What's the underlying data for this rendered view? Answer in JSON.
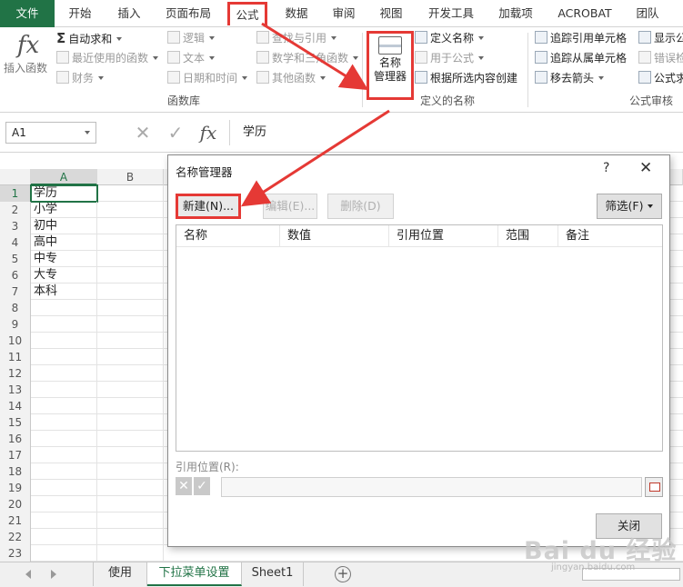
{
  "ribbon_tabs": [
    "文件",
    "开始",
    "插入",
    "页面布局",
    "公式",
    "数据",
    "审阅",
    "视图",
    "开发工具",
    "加载项",
    "ACROBAT",
    "团队"
  ],
  "ribbon": {
    "insert_function": "插入函数",
    "library": {
      "autosum": "自动求和",
      "recent": "最近使用的函数",
      "financial": "财务",
      "logical": "逻辑",
      "text": "文本",
      "datetime": "日期和时间",
      "lookup": "查找与引用",
      "math": "数学和三角函数",
      "more": "其他函数",
      "group_label": "函数库"
    },
    "names": {
      "name_manager": [
        "名称",
        "管理器"
      ],
      "define_name": "定义名称",
      "use_in_formula": "用于公式",
      "create_from_selection": "根据所选内容创建",
      "group_label": "定义的名称"
    },
    "audit": {
      "trace_precedents": "追踪引用单元格",
      "trace_dependents": "追踪从属单元格",
      "remove_arrows": "移去箭头",
      "show_formulas": "显示公",
      "error_checking": "错误检",
      "evaluate": "公式求",
      "group_label": "公式审核"
    }
  },
  "formula_bar": {
    "name_box": "A1",
    "fx": "fx",
    "content": "学历"
  },
  "grid": {
    "columns": [
      "A",
      "B"
    ],
    "row_numbers": [
      "1",
      "2",
      "3",
      "4",
      "5",
      "6",
      "7",
      "8",
      "9",
      "10",
      "11",
      "12",
      "13",
      "14",
      "15",
      "16",
      "17",
      "18",
      "19",
      "20",
      "21",
      "22",
      "23"
    ],
    "column_a": [
      "学历",
      "小学",
      "初中",
      "高中",
      "中专",
      "大专",
      "本科"
    ]
  },
  "sheets": [
    "使用表",
    "下拉菜单设置",
    "Sheet1"
  ],
  "active_sheet": "下拉菜单设置",
  "dialog": {
    "title": "名称管理器",
    "help": "?",
    "close": "✕",
    "new_btn": "新建(N)...",
    "edit_btn": "编辑(E)...",
    "delete_btn": "删除(D)",
    "filter_btn": "筛选(F)",
    "list_headers": [
      "名称",
      "数值",
      "引用位置",
      "范围",
      "备注"
    ],
    "refers_to_label": "引用位置(R):",
    "close_btn": "关闭"
  },
  "watermark": {
    "brand": "Bai du 经验",
    "url": "jingyan.baidu.com"
  },
  "colors": {
    "excel_green": "#217346",
    "highlight_red": "#e53935"
  }
}
